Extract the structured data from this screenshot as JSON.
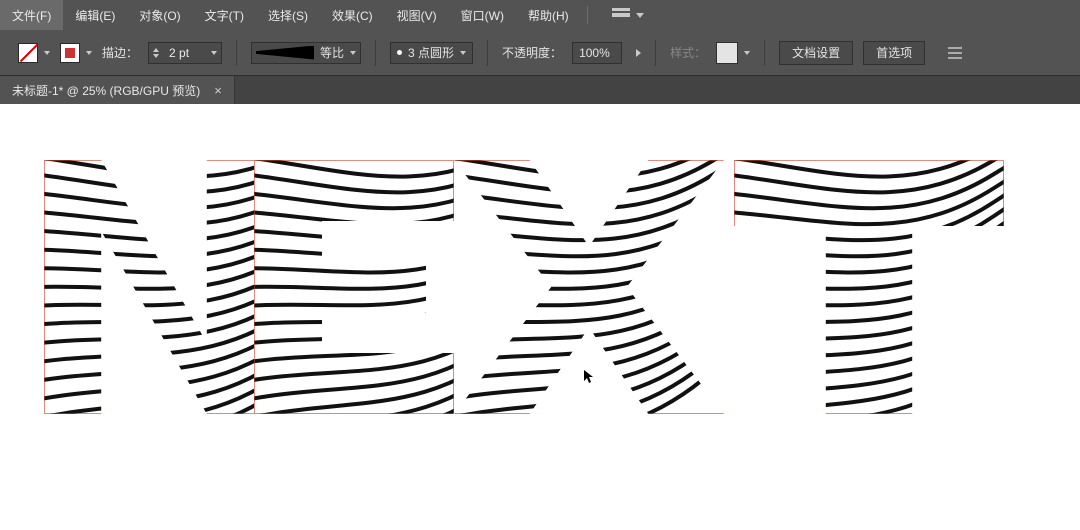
{
  "menu": {
    "file": "文件(F)",
    "edit": "编辑(E)",
    "object": "对象(O)",
    "type": "文字(T)",
    "select": "选择(S)",
    "effect": "效果(C)",
    "view": "视图(V)",
    "window": "窗口(W)",
    "help": "帮助(H)"
  },
  "control": {
    "stroke_label": "描边：",
    "stroke_width": "2 pt",
    "profile_label": "等比",
    "brush_label": "3 点圆形",
    "opacity_label": "不透明度：",
    "opacity_value": "100%",
    "style_label": "样式：",
    "doc_setup": "文档设置",
    "prefs": "首选项"
  },
  "tab": {
    "title": "未标题-1* @ 25% (RGB/GPU 预览)",
    "close": "×"
  }
}
